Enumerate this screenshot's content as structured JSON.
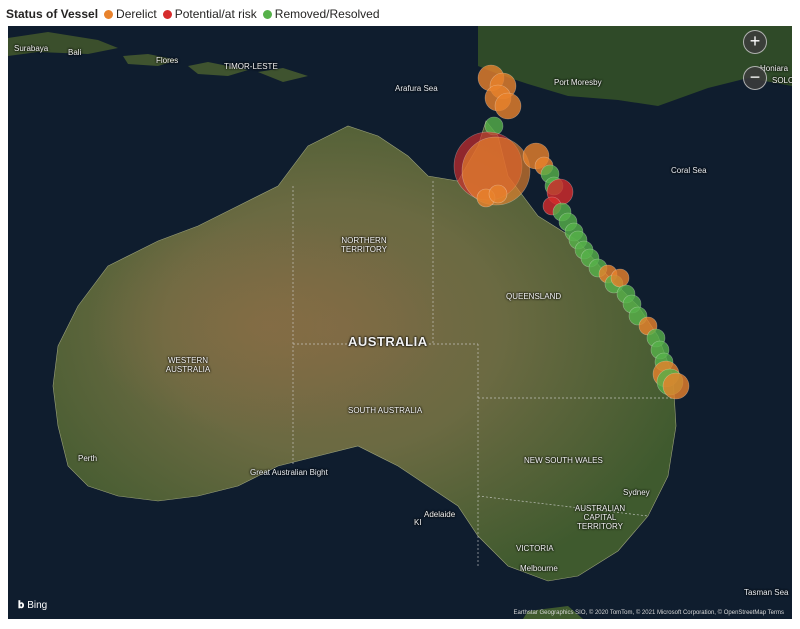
{
  "legend": {
    "title": "Status of Vessel",
    "items": [
      {
        "label": "Derelict",
        "color": "#e8822c"
      },
      {
        "label": "Potential/at risk",
        "color": "#d62c2c"
      },
      {
        "label": "Removed/Resolved",
        "color": "#56b14a"
      }
    ]
  },
  "colors": {
    "derelict": "#e8822c",
    "at_risk": "#d62c2c",
    "resolved": "#56b14a",
    "ocean": "#0f1d2e",
    "land": "#56633c"
  },
  "controls": {
    "zoom_in": "+",
    "zoom_out": "−"
  },
  "labels": {
    "surabaya": "Surabaya",
    "bali": "Bali",
    "flores": "Flores",
    "timor_leste": "TIMOR-LESTE",
    "arafura_sea": "Arafura Sea",
    "port_moresby": "Port Moresby",
    "honiara": "Honiara",
    "solo": "SOLO",
    "coral_sea": "Coral Sea",
    "northern_territory": "NORTHERN TERRITORY",
    "queensland": "QUEENSLAND",
    "australia": "AUSTRALIA",
    "western_australia": "WESTERN AUSTRALIA",
    "south_australia": "SOUTH AUSTRALIA",
    "perth": "Perth",
    "great_australian_bight": "Great Australian Bight",
    "new_south_wales": "NEW SOUTH WALES",
    "sydney": "Sydney",
    "act": "AUSTRALIAN CAPITAL TERRITORY",
    "adelaide": "Adelaide",
    "ki": "KI",
    "victoria": "VICTORIA",
    "melbourne": "Melbourne",
    "tasman_sea": "Tasman Sea"
  },
  "footer": {
    "bing": "Bing",
    "attribution": "Earthstar Geographics SIO, © 2020 TomTom, © 2021 Microsoft Corporation, © OpenStreetMap",
    "terms": "Terms"
  },
  "vessels": [
    {
      "status": "derelict",
      "size": "medium"
    },
    {
      "status": "derelict",
      "size": "medium"
    },
    {
      "status": "derelict",
      "size": "medium"
    },
    {
      "status": "derelict",
      "size": "medium"
    },
    {
      "status": "resolved",
      "size": "small"
    },
    {
      "status": "at_risk",
      "size": "large"
    },
    {
      "status": "derelict",
      "size": "large"
    },
    {
      "status": "derelict",
      "size": "medium"
    },
    {
      "status": "derelict",
      "size": "small"
    },
    {
      "status": "resolved",
      "size": "small"
    },
    {
      "status": "derelict",
      "size": "small"
    },
    {
      "status": "derelict",
      "size": "small"
    },
    {
      "status": "resolved",
      "size": "small"
    },
    {
      "status": "at_risk",
      "size": "medium"
    },
    {
      "status": "at_risk",
      "size": "small"
    },
    {
      "status": "resolved",
      "size": "small"
    },
    {
      "status": "resolved",
      "size": "small"
    },
    {
      "status": "resolved",
      "size": "small"
    },
    {
      "status": "resolved",
      "size": "small"
    },
    {
      "status": "resolved",
      "size": "small"
    },
    {
      "status": "resolved",
      "size": "small"
    },
    {
      "status": "resolved",
      "size": "small"
    },
    {
      "status": "derelict",
      "size": "small"
    },
    {
      "status": "resolved",
      "size": "small"
    },
    {
      "status": "derelict",
      "size": "small"
    },
    {
      "status": "resolved",
      "size": "small"
    },
    {
      "status": "resolved",
      "size": "small"
    },
    {
      "status": "resolved",
      "size": "small"
    },
    {
      "status": "derelict",
      "size": "small"
    },
    {
      "status": "resolved",
      "size": "small"
    },
    {
      "status": "resolved",
      "size": "small"
    },
    {
      "status": "resolved",
      "size": "small"
    },
    {
      "status": "derelict",
      "size": "medium"
    },
    {
      "status": "resolved",
      "size": "medium"
    },
    {
      "status": "derelict",
      "size": "medium"
    }
  ]
}
